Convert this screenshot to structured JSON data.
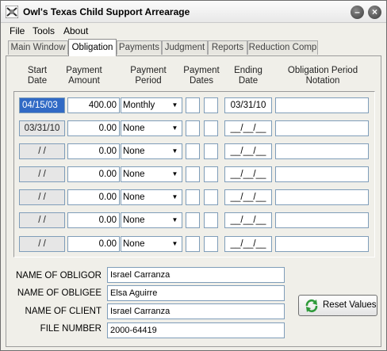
{
  "window": {
    "title": "Owl's Texas Child Support Arrearage",
    "minimize_glyph": "–",
    "close_glyph": "×"
  },
  "menu": {
    "file": "File",
    "tools": "Tools",
    "about": "About"
  },
  "tabs": [
    {
      "label": "Main Window",
      "active": false
    },
    {
      "label": "Obligation",
      "active": true
    },
    {
      "label": "Payments",
      "active": false
    },
    {
      "label": "Judgment",
      "active": false
    },
    {
      "label": "Reports",
      "active": false
    },
    {
      "label": "Reduction Comp",
      "active": false
    }
  ],
  "columns": {
    "start_date": "Start Date",
    "payment_amount": "Payment Amount",
    "payment_period": "Payment Period",
    "payment_dates": "Payment Dates",
    "ending_date": "Ending Date",
    "notation": "Obligation Period Notation"
  },
  "rows": [
    {
      "start": "04/15/03",
      "amount": "400.00",
      "period": "Monthly",
      "ending": "03/31/10",
      "notation": ""
    },
    {
      "start": "03/31/10",
      "amount": "0.00",
      "period": "None",
      "ending": "__/__/__",
      "notation": ""
    },
    {
      "start": "/ /",
      "amount": "0.00",
      "period": "None",
      "ending": "__/__/__",
      "notation": ""
    },
    {
      "start": "/ /",
      "amount": "0.00",
      "period": "None",
      "ending": "__/__/__",
      "notation": ""
    },
    {
      "start": "/ /",
      "amount": "0.00",
      "period": "None",
      "ending": "__/__/__",
      "notation": ""
    },
    {
      "start": "/ /",
      "amount": "0.00",
      "period": "None",
      "ending": "__/__/__",
      "notation": ""
    },
    {
      "start": "/ /",
      "amount": "0.00",
      "period": "None",
      "ending": "__/__/__",
      "notation": ""
    }
  ],
  "info": {
    "obligor_label": "NAME OF OBLIGOR",
    "obligor": "Israel Carranza",
    "obligee_label": "NAME OF OBLIGEE",
    "obligee": "Elsa Aguirre",
    "client_label": "NAME OF CLIENT",
    "client": "Israel Carranza",
    "file_label": "FILE NUMBER",
    "file": "2000-64419"
  },
  "reset_button": {
    "label": "Reset Values",
    "icon": "refresh-icon"
  },
  "colors": {
    "selection": "#316ac5",
    "field_border": "#7f9db9",
    "window_bg": "#f0efe9",
    "refresh_green": "#2e9a3a"
  }
}
